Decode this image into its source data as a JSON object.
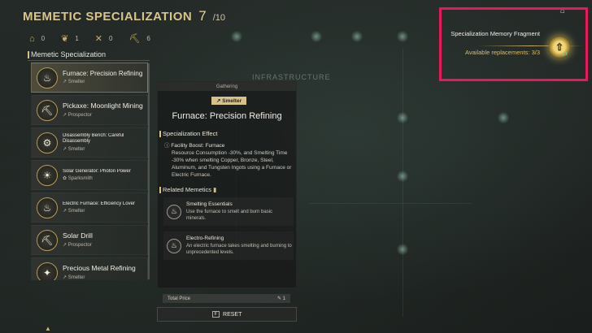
{
  "header": {
    "title": "MEMETIC SPECIALIZATION",
    "count": "7",
    "max": "/10"
  },
  "stats": [
    {
      "icon": "house-icon",
      "glyph": "⌂",
      "value": "0"
    },
    {
      "icon": "leaf-icon",
      "glyph": "❦",
      "value": "1"
    },
    {
      "icon": "crossed-tools-icon",
      "glyph": "✕",
      "value": "0"
    },
    {
      "icon": "pickaxe-icon",
      "glyph": "⛏",
      "value": "6"
    }
  ],
  "list": {
    "title": "Memetic Specialization",
    "items": [
      {
        "name": "Furnace: Precision Refining",
        "role": "↗ Smelter",
        "size": "md",
        "selected": true
      },
      {
        "name": "Pickaxe: Moonlight Mining",
        "role": "↗ Prospector",
        "size": "lg"
      },
      {
        "name": "Disassembly Bench: Careful Disassembly",
        "role": "↗ Smelter",
        "size": "sm"
      },
      {
        "name": "Solar Generator: Photon Power",
        "role": "✿ Sparksmith",
        "size": "sm"
      },
      {
        "name": "Electric Furnace: Efficiency Lover",
        "role": "↗ Smelter",
        "size": "sm"
      },
      {
        "name": "Solar Drill",
        "role": "↗ Prospector",
        "size": "lg"
      },
      {
        "name": "Precious Metal Refining",
        "role": "↗ Smelter",
        "size": "lg"
      }
    ]
  },
  "detail": {
    "category": "Gathering",
    "tag": "↗ Smelter",
    "name": "Furnace: Precision Refining",
    "effect_heading": "Specialization Effect",
    "effect_title": "Facility Boost: Furnace",
    "effect_text": "Resource Consumption -30%, and Smelting Time -30% when smelting Copper, Bronze, Steel, Aluminum, and Tungsten Ingots using a Furnace or Electric Furnace.",
    "related_heading": "Related Memetics",
    "memetics": [
      {
        "name": "Smelting Essentials",
        "desc": "Use the furnace to smelt and burn basic minerals."
      },
      {
        "name": "Electro-Refining",
        "desc": "An electric furnace takes smelting and burning to unprecedented levels."
      }
    ]
  },
  "price": {
    "label": "Total Price",
    "value": "1"
  },
  "reset": {
    "key": "F",
    "label": "RESET"
  },
  "fragment": {
    "title": "Specialization Memory Fragment",
    "replacements": "Available replacements: 3/3"
  },
  "background": {
    "struct_label": "INFRASTRUCTURE"
  },
  "colors": {
    "accent": "#d8c27e",
    "highlight": "#e8195a",
    "teal": "#54d9b5"
  }
}
